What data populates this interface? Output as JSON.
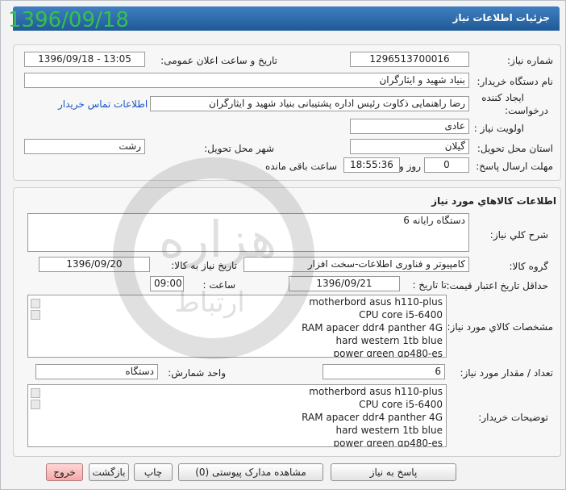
{
  "date_stamp": "1396/09/18",
  "header": {
    "title": "جزئیات اطلاعات نیاز"
  },
  "request": {
    "need_number_label": "شماره نیاز:",
    "need_number": "1296513700016",
    "announce_label": "تاریخ و ساعت اعلان عمومی:",
    "announce_value": "1396/09/18 - 13:05",
    "buyer_org_label": "نام دستگاه خریدار:",
    "buyer_org": "بنیاد شهید و ایثارگران",
    "creator_label_1": "ایجاد کننده",
    "creator_label_2": "درخواست:",
    "creator": "رضا راهنمایی ذکاوت رئیس اداره پشتیبانی بنیاد شهید و ایثارگران",
    "contact_link": "اطلاعات تماس خریدار",
    "priority_label": "اولویت نیاز :",
    "priority": "عادی",
    "province_label": "استان محل تحویل:",
    "province": "گیلان",
    "city_label": "شهر محل تحویل:",
    "city": "رشت",
    "deadline_label": "مهلت ارسال پاسخ:",
    "deadline_days": "0",
    "days_word": "روز و",
    "deadline_time": "18:55:36",
    "remaining_word": "ساعت باقی مانده"
  },
  "goods": {
    "section_title": "اطلاعات کالاهاي مورد نياز",
    "general_desc_label": "شرح کلي نياز:",
    "general_desc": "6 دستگاه رایانه",
    "group_label": "گروه کالا:",
    "group": "کامپیوتر و فناوری اطلاعات-سخت افزار",
    "need_date_label": "تاریخ نیاز به کالا:",
    "need_date": "1396/09/20",
    "price_validity_label": "حداقل تاریخ اعتبار قیمت:",
    "until_date_label": "تا تاریخ :",
    "until_date": "1396/09/21",
    "time_label": "ساعت :",
    "time": "09:00",
    "specs_label": "مشخصات کالاي مورد نياز:",
    "specs": [
      "motherbord asus h110-plus",
      "CPU core i5-6400",
      "RAM apacer ddr4 panther 4G",
      "hard western 1tb blue",
      "power green gp480-es"
    ],
    "qty_label": "تعداد / مقدار مورد نیاز:",
    "qty": "6",
    "unit_label": "واحد شمارش:",
    "unit": "دستگاه",
    "buyer_notes_label": "توضیحات خریدار:",
    "buyer_notes": [
      "motherbord asus h110-plus",
      "CPU core i5-6400",
      "RAM apacer ddr4 panther 4G",
      "hard western 1tb blue",
      "power green gp480-es"
    ]
  },
  "footer": {
    "reply_button": "پاسخ به نیاز",
    "attachments_button": "مشاهده مدارک پیوستی (0)",
    "print_button": "چاپ",
    "back_button": "بازگشت",
    "exit_button": "خروج"
  },
  "watermark": {
    "line1": "هزاره",
    "line2": "ارتباط"
  },
  "colors": {
    "title_bar": "#2d6aab",
    "date_stamp": "#35c24a",
    "link": "#1a56c8",
    "exit_button": "#f3a9a9"
  }
}
